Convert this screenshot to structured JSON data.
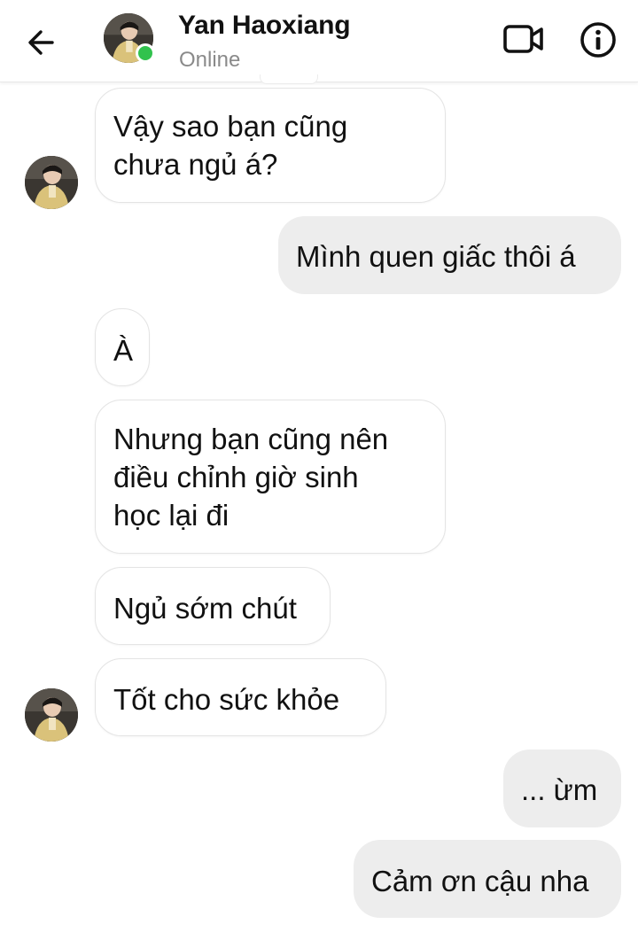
{
  "header": {
    "contact_name": "Yan Haoxiang",
    "status": "Online",
    "icons": {
      "back": "arrow-left-icon",
      "video": "video-camera-icon",
      "info": "info-icon"
    },
    "colors": {
      "online": "#31c24d",
      "status_text": "#8a8a8a"
    }
  },
  "messages": [
    {
      "direction": "in",
      "lines": [
        "Vậy sao bạn cũng",
        "chưa ngủ á?"
      ]
    },
    {
      "direction": "out",
      "lines": [
        "Mình quen giấc thôi á"
      ]
    },
    {
      "direction": "in",
      "lines": [
        "À"
      ]
    },
    {
      "direction": "in",
      "lines": [
        "Nhưng bạn cũng nên",
        "điều chỉnh giờ sinh",
        "học lại đi"
      ]
    },
    {
      "direction": "in",
      "lines": [
        "Ngủ sớm chút"
      ]
    },
    {
      "direction": "in",
      "lines": [
        "Tốt cho sức khỏe"
      ]
    },
    {
      "direction": "out",
      "lines": [
        "... ừm"
      ]
    },
    {
      "direction": "out",
      "lines": [
        "Cảm ơn cậu nha"
      ]
    }
  ],
  "colors": {
    "incoming_bubble": "#ffffff",
    "outgoing_bubble": "#ededed",
    "text": "#111111"
  }
}
